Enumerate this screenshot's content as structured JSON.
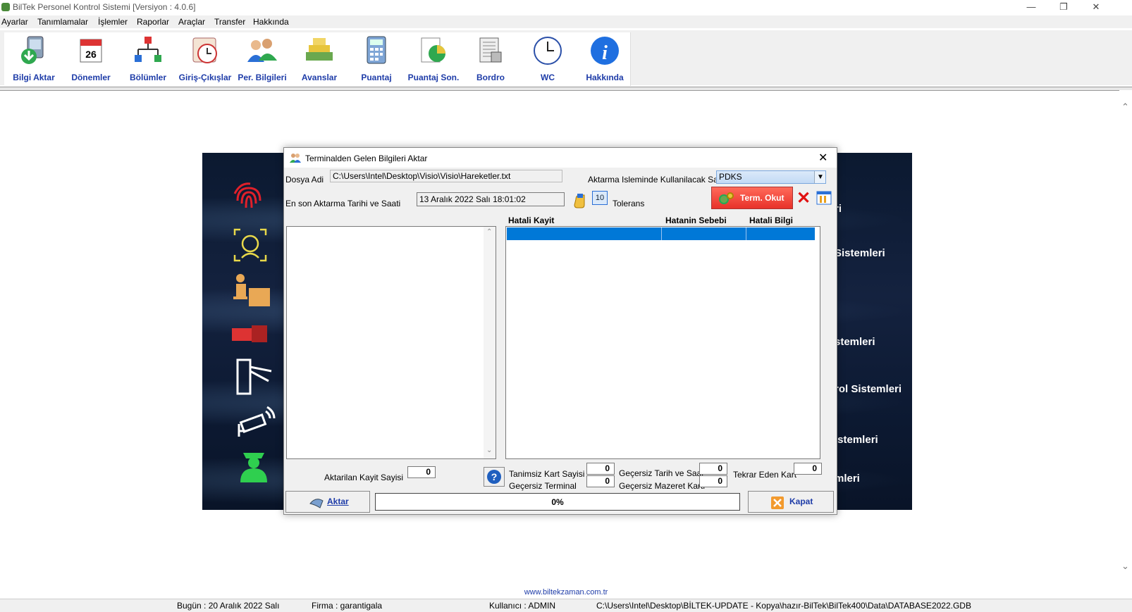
{
  "window": {
    "title": "BilTek Personel Kontrol Sistemi [Versiyon : 4.0.6]"
  },
  "menu": [
    "Ayarlar",
    "Tanımlamalar",
    "İşlemler",
    "Raporlar",
    "Araçlar",
    "Transfer",
    "Hakkında"
  ],
  "toolbar": [
    {
      "label": "Bilgi Aktar",
      "icon": "download-device-icon"
    },
    {
      "label": "Dönemler",
      "icon": "calendar-icon"
    },
    {
      "label": "Bölümler",
      "icon": "org-chart-icon"
    },
    {
      "label": "Giriş-Çıkışlar",
      "icon": "clock-icon"
    },
    {
      "label": "Per. Bilgileri",
      "icon": "people-icon"
    },
    {
      "label": "Avanslar",
      "icon": "money-icon"
    },
    {
      "label": "Puantaj",
      "icon": "calculator-icon"
    },
    {
      "label": "Puantaj Son.",
      "icon": "pie-chart-icon"
    },
    {
      "label": "Bordro",
      "icon": "document-icon"
    },
    {
      "label": "WC",
      "icon": "wall-clock-icon"
    },
    {
      "label": "Hakkında",
      "icon": "info-icon"
    }
  ],
  "background_right_text": [
    "ri",
    "Sistemleri",
    "stemleri",
    "rol Sistemleri",
    "istemleri",
    "mleri"
  ],
  "dialog": {
    "title": "Terminalden Gelen Bilgileri Aktar",
    "file_label": "Dosya Adi",
    "file_value": "C:\\Users\\Intel\\Desktop\\Visio\\Visio\\Hareketler.txt",
    "clock_label": "Aktarma Isleminde Kullanilacak Saat",
    "clock_value": "PDKS",
    "last_transfer_label": "En son Aktarma Tarihi ve Saati",
    "last_transfer_value": "13 Aralık 2022 Salı  18:01:02",
    "tolerance_value": "10",
    "tolerance_label": "Tolerans",
    "read_terminal_button": "Term. Okut",
    "error_table_headers": [
      "Hatali Kayit",
      "Hatanin Sebebi",
      "Hatali Bilgi"
    ],
    "transferred_count_label": "Aktarilan Kayit Sayisi",
    "transferred_count": "0",
    "undefined_card_label": "Tanimsiz Kart Sayisi",
    "undefined_card": "0",
    "invalid_datetime_label": "Geçersiz Tarih ve Saat",
    "invalid_datetime": "0",
    "repeat_card_label": "Tekrar Eden Kart",
    "repeat_card": "0",
    "invalid_terminal_label": "Geçersiz Terminal",
    "invalid_terminal": "0",
    "invalid_excuse_label": "Geçersiz Mazeret Karti",
    "invalid_excuse": "0",
    "transfer_button": "Aktar",
    "progress_text": "0%",
    "progress": 0,
    "close_button": "Kapat"
  },
  "footer": {
    "website": "www.biltekzaman.com.tr",
    "today": "Bugün : 20 Aralık 2022 Salı",
    "company": "Firma : garantigala",
    "user": "Kullanıcı : ADMIN",
    "db_path": "C:\\Users\\Intel\\Desktop\\BİLTEK-UPDATE - Kopya\\hazır-BilTek\\BilTek400\\Data\\DATABASE2022.GDB"
  },
  "colors": {
    "accent": "#1e3ca8",
    "selection": "#0078d7",
    "read_button": "#e8322a"
  }
}
